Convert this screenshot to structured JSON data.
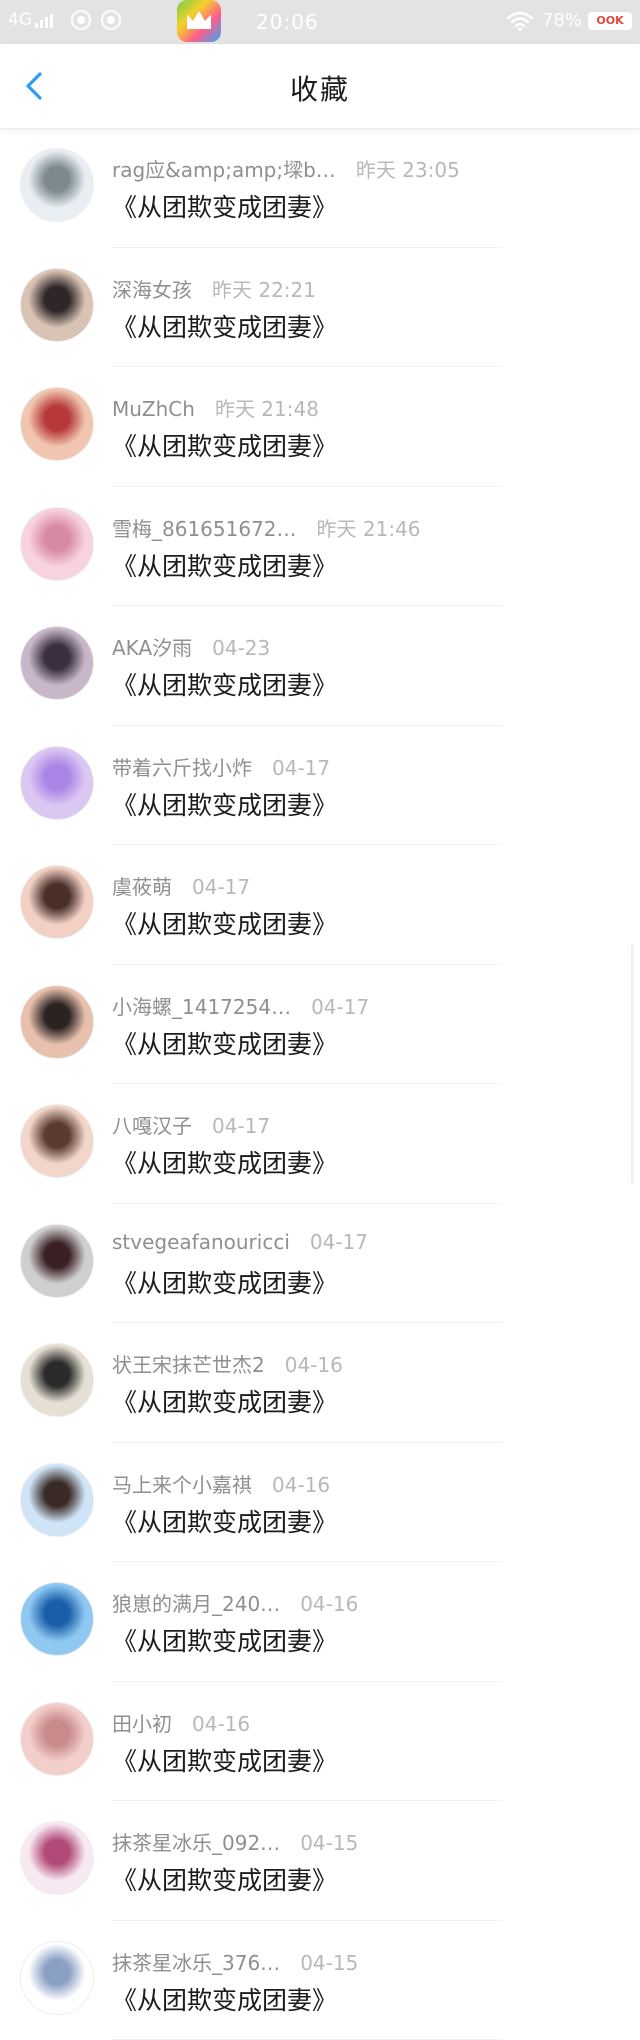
{
  "status_bar": {
    "network": "4G",
    "time": "20:06",
    "battery": "78%"
  },
  "header": {
    "title": "收藏"
  },
  "list": [
    {
      "name": "rag应&amp;amp;墚b…",
      "time": "昨天 23:05",
      "title": "《从团欺变成团妻》",
      "avatar_colors": [
        "#e9eef2",
        "#7c8a8f"
      ]
    },
    {
      "name": "深海女孩",
      "time": "昨天 22:21",
      "title": "《从团欺变成团妻》",
      "avatar_colors": [
        "#d9c3b5",
        "#2e2628"
      ]
    },
    {
      "name": "MuZhCh",
      "time": "昨天 21:48",
      "title": "《从团欺变成团妻》",
      "avatar_colors": [
        "#f0c6b0",
        "#b73838"
      ]
    },
    {
      "name": "雪梅_861651672…",
      "time": "昨天 21:46",
      "title": "《从团欺变成团妻》",
      "avatar_colors": [
        "#f7d3de",
        "#d98aa3"
      ]
    },
    {
      "name": "AKA汐雨",
      "time": "04-23",
      "title": "《从团欺变成团妻》",
      "avatar_colors": [
        "#c7b7c9",
        "#3b2f3f"
      ]
    },
    {
      "name": "带着六斤找小炸",
      "time": "04-17",
      "title": "《从团欺变成团妻》",
      "avatar_colors": [
        "#dcc7f3",
        "#a986e6"
      ]
    },
    {
      "name": "虞莜萌",
      "time": "04-17",
      "title": "《从团欺变成团妻》",
      "avatar_colors": [
        "#f2d1c4",
        "#4a2e28"
      ]
    },
    {
      "name": "小海螺_1417254…",
      "time": "04-17",
      "title": "《从团欺变成团妻》",
      "avatar_colors": [
        "#e8c1ae",
        "#2b2322"
      ]
    },
    {
      "name": "八嘎汉子",
      "time": "04-17",
      "title": "《从团欺变成团妻》",
      "avatar_colors": [
        "#f1d6c9",
        "#5a3b30"
      ]
    },
    {
      "name": "stvegeafanouricci",
      "time": "04-17",
      "title": "《从团欺变成团妻》",
      "avatar_colors": [
        "#cfcfcf",
        "#3a1f24"
      ]
    },
    {
      "name": "状王宋抹芒世杰2",
      "time": "04-16",
      "title": "《从团欺变成团妻》",
      "avatar_colors": [
        "#e6e0d4",
        "#2a2a2a"
      ]
    },
    {
      "name": "马上来个小嘉祺",
      "time": "04-16",
      "title": "《从团欺变成团妻》",
      "avatar_colors": [
        "#cfe4f6",
        "#3a2a26"
      ]
    },
    {
      "name": "狼崽的满月_240…",
      "time": "04-16",
      "title": "《从团欺变成团妻》",
      "avatar_colors": [
        "#8fc9f2",
        "#1a5ea8"
      ]
    },
    {
      "name": "田小初",
      "time": "04-16",
      "title": "《从团欺变成团妻》",
      "avatar_colors": [
        "#f3cfcc",
        "#c98a8a"
      ]
    },
    {
      "name": "抹茶星冰乐_092…",
      "time": "04-15",
      "title": "《从团欺变成团妻》",
      "avatar_colors": [
        "#f7e9f1",
        "#b14a7a"
      ]
    },
    {
      "name": "抹茶星冰乐_376…",
      "time": "04-15",
      "title": "《从团欺变成团妻》",
      "avatar_colors": [
        "#ffffff",
        "#8a9fc4"
      ]
    }
  ]
}
